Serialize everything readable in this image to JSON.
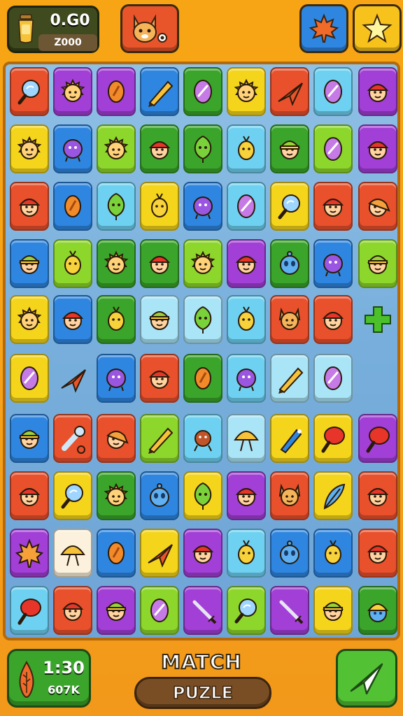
{
  "header": {
    "score_top": "0.G0",
    "score_bottom": "Z000"
  },
  "footer": {
    "timer": "1:30",
    "timer_sub": "607K",
    "title_line1": "MATCH",
    "title_line2": "PUZLE"
  },
  "colors": {
    "red": "#e9502c",
    "purple": "#a23fd6",
    "blue": "#2f86e0",
    "green": "#3aa52a",
    "lime": "#8dd62c",
    "yellow": "#f5d51c",
    "cyan": "#6fd1f2",
    "sky": "#a9e4f7",
    "white": "#fbf1dc"
  },
  "board": {
    "rows": [
      [
        [
          "red",
          "magnifier-icon"
        ],
        [
          "purple",
          "sun-face-icon"
        ],
        [
          "purple",
          "bean-icon"
        ],
        [
          "blue",
          "pencil-icon"
        ],
        [
          "green",
          "shield-icon"
        ],
        [
          "yellow",
          "sun-face-icon"
        ],
        [
          "red",
          "paper-plane-icon"
        ],
        [
          "cyan",
          "shield-icon"
        ],
        [
          "purple",
          "cap-boy-icon"
        ]
      ],
      [
        [
          "yellow",
          "sun-face-icon"
        ],
        [
          "blue",
          "blob-creature-icon"
        ],
        [
          "lime",
          "sun-face-icon"
        ],
        [
          "green",
          "cap-boy-icon"
        ],
        [
          "green",
          "leaf-creature-icon"
        ],
        [
          "cyan",
          "sprout-creature-icon"
        ],
        [
          "green",
          "beanie-boy-icon"
        ],
        [
          "lime",
          "shield-icon"
        ],
        [
          "purple",
          "cap-boy-icon"
        ]
      ],
      [
        [
          "red",
          "cap-boy-icon"
        ],
        [
          "blue",
          "bean-icon"
        ],
        [
          "cyan",
          "leaf-creature-icon"
        ],
        [
          "yellow",
          "sprout-creature-icon"
        ],
        [
          "blue",
          "blob-creature-icon"
        ],
        [
          "cyan",
          "shield-icon"
        ],
        [
          "yellow",
          "magnifier-icon"
        ],
        [
          "red",
          "cap-boy-icon"
        ],
        [
          "red",
          "ponytail-girl-icon"
        ]
      ],
      [
        [
          "blue",
          "beanie-boy-icon"
        ],
        [
          "lime",
          "sprout-creature-icon"
        ],
        [
          "green",
          "sun-face-icon"
        ],
        [
          "green",
          "cap-boy-icon"
        ],
        [
          "lime",
          "sun-face-icon"
        ],
        [
          "purple",
          "cap-boy-icon"
        ],
        [
          "green",
          "alien-icon"
        ],
        [
          "blue",
          "blob-creature-icon"
        ],
        [
          "lime",
          "beanie-boy-icon"
        ]
      ],
      [
        [
          "yellow",
          "sun-face-icon"
        ],
        [
          "blue",
          "cap-boy-icon"
        ],
        [
          "green",
          "sprout-creature-icon"
        ],
        [
          "sky",
          "beanie-boy-icon"
        ],
        [
          "sky",
          "leaf-creature-icon"
        ],
        [
          "cyan",
          "sprout-creature-icon"
        ],
        [
          "red",
          "fox-face-icon"
        ],
        [
          "red",
          "cap-boy-icon"
        ],
        [
          "none",
          "plus-icon"
        ]
      ],
      [
        [
          "yellow",
          "shield-icon"
        ],
        [
          "none",
          "paper-plane-icon"
        ],
        [
          "blue",
          "blob-creature-icon"
        ],
        [
          "red",
          "cap-boy-icon"
        ],
        [
          "green",
          "bean-icon"
        ],
        [
          "cyan",
          "blob-creature-icon"
        ],
        [
          "sky",
          "pencil-icon"
        ],
        [
          "sky",
          "shield-icon"
        ],
        [
          "none",
          ""
        ]
      ],
      [
        [
          "blue",
          "beanie-boy-icon"
        ],
        [
          "red",
          "wrench-icon"
        ],
        [
          "red",
          "ponytail-girl-icon"
        ],
        [
          "lime",
          "pencil-icon"
        ],
        [
          "cyan",
          "ant-creature-icon"
        ],
        [
          "sky",
          "mushroom-icon"
        ],
        [
          "yellow",
          "pen-icon"
        ],
        [
          "yellow",
          "racket-icon"
        ],
        [
          "purple",
          "racket-icon"
        ]
      ],
      [
        [
          "red",
          "cap-boy-icon"
        ],
        [
          "yellow",
          "magnifier-icon"
        ],
        [
          "green",
          "sun-face-icon"
        ],
        [
          "blue",
          "alien-icon"
        ],
        [
          "yellow",
          "leaf-creature-icon"
        ],
        [
          "purple",
          "cap-boy-icon"
        ],
        [
          "red",
          "fox-face-icon"
        ],
        [
          "yellow",
          "feather-icon"
        ],
        [
          "red",
          "cap-boy-icon"
        ]
      ],
      [
        [
          "purple",
          "maple-leaf-icon"
        ],
        [
          "white",
          "mushroom-icon"
        ],
        [
          "blue",
          "bean-icon"
        ],
        [
          "yellow",
          "paper-plane-icon"
        ],
        [
          "purple",
          "cap-boy-icon"
        ],
        [
          "cyan",
          "sprout-creature-icon"
        ],
        [
          "blue",
          "alien-icon"
        ],
        [
          "blue",
          "sprout-creature-icon"
        ],
        [
          "red",
          "cap-boy-icon"
        ]
      ],
      [
        [
          "cyan",
          "racket-icon"
        ],
        [
          "red",
          "cap-boy-icon"
        ],
        [
          "purple",
          "beanie-boy-icon"
        ],
        [
          "lime",
          "shield-icon"
        ],
        [
          "purple",
          "sword-icon"
        ],
        [
          "lime",
          "magnifier-icon"
        ],
        [
          "purple",
          "sword-icon"
        ],
        [
          "yellow",
          "beanie-boy-icon"
        ],
        [
          "green",
          "beanie-alien-icon"
        ]
      ]
    ]
  }
}
